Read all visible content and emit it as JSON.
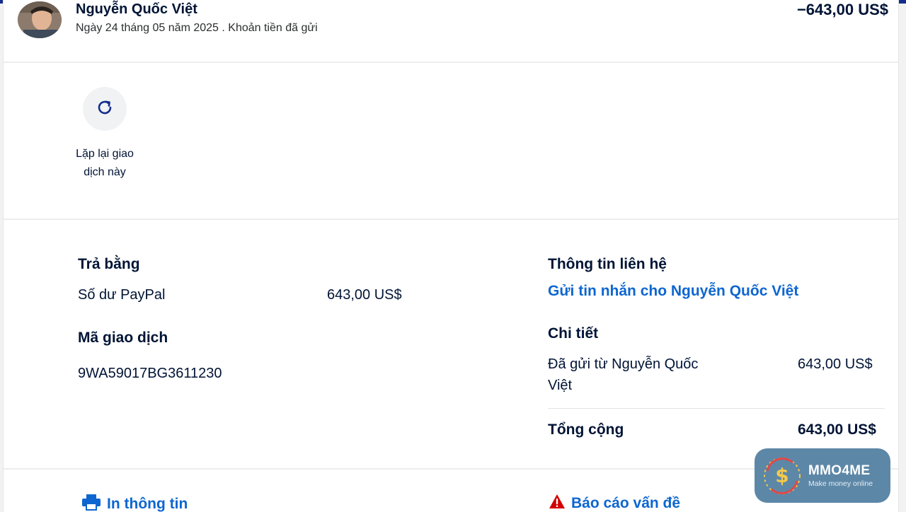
{
  "header": {
    "name": "Nguyễn Quốc Việt",
    "subline": "Ngày 24 tháng 05 năm 2025 . Khoản tiền đã gửi",
    "amount": "−643,00 US$"
  },
  "repeat": {
    "label": "Lặp lại giao dịch này"
  },
  "payment": {
    "heading": "Trả bằng",
    "method": "Số dư PayPal",
    "amount": "643,00 US$"
  },
  "transaction": {
    "heading": "Mã giao dịch",
    "id": "9WA59017BG3611230"
  },
  "contact": {
    "heading": "Thông tin liên hệ",
    "message_link": "Gửi tin nhắn cho Nguyễn Quốc Việt"
  },
  "details": {
    "heading": "Chi tiết",
    "sent_from_line1": "Đã gửi từ Nguyễn Quốc",
    "sent_from_line2": "Việt",
    "sent_amount": "643,00 US$",
    "total_label": "Tổng cộng",
    "total_amount": "643,00 US$"
  },
  "footer": {
    "print_label": "In thông tin",
    "report_label": "Báo cáo vấn đề"
  },
  "watermark": {
    "title": "MMO4ME",
    "subtitle": "Make money online"
  },
  "colors": {
    "accent_blue": "#0d66d0",
    "top_bar": "#142c8e",
    "warning_red": "#d20000"
  }
}
